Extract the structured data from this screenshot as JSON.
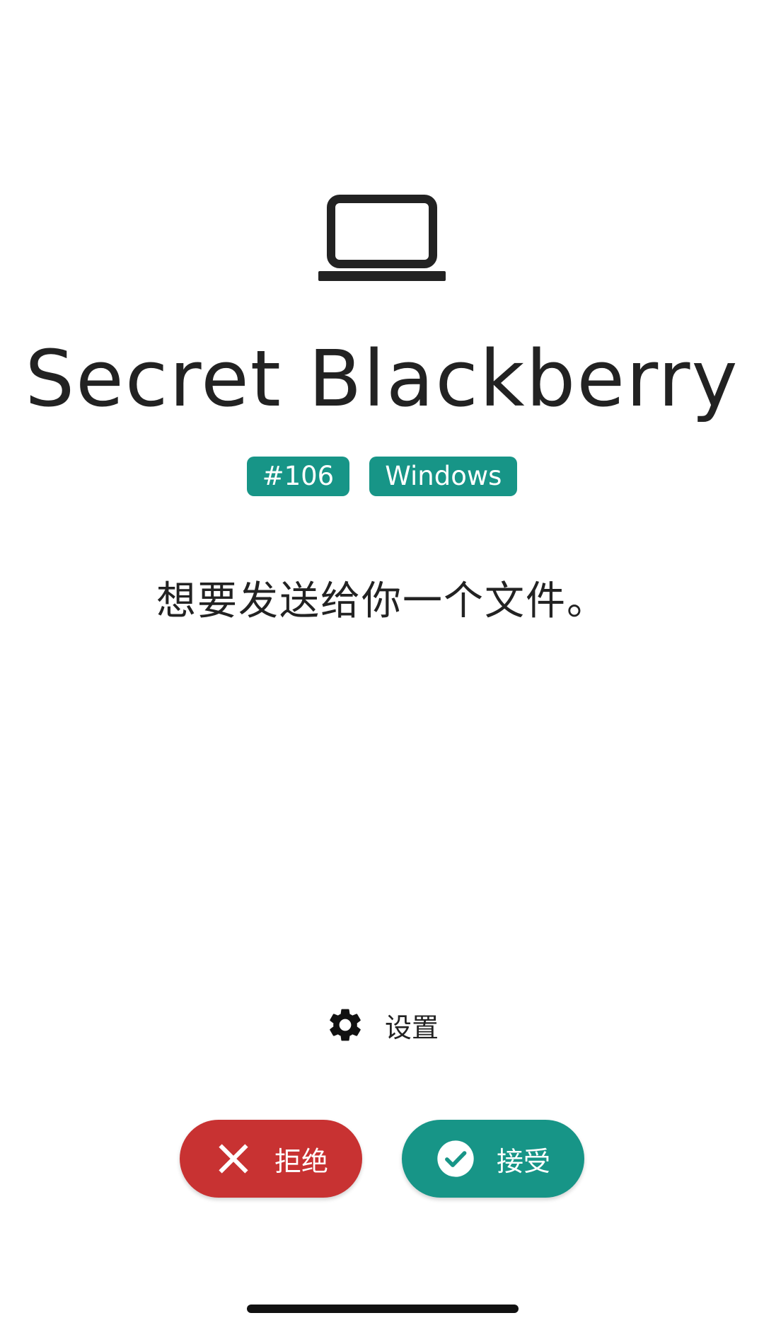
{
  "device": {
    "icon": "laptop-icon",
    "name": "Secret Blackberry",
    "tags": [
      "#106",
      "Windows"
    ]
  },
  "message": "想要发送给你一个文件。",
  "settings": {
    "icon": "gear-icon",
    "label": "设置"
  },
  "actions": {
    "reject": {
      "icon": "close-icon",
      "label": "拒绝",
      "color": "#c83232"
    },
    "accept": {
      "icon": "check-circle-icon",
      "label": "接受",
      "color": "#179587"
    }
  },
  "colors": {
    "accent": "#179587",
    "danger": "#c83232",
    "text": "#222222"
  }
}
